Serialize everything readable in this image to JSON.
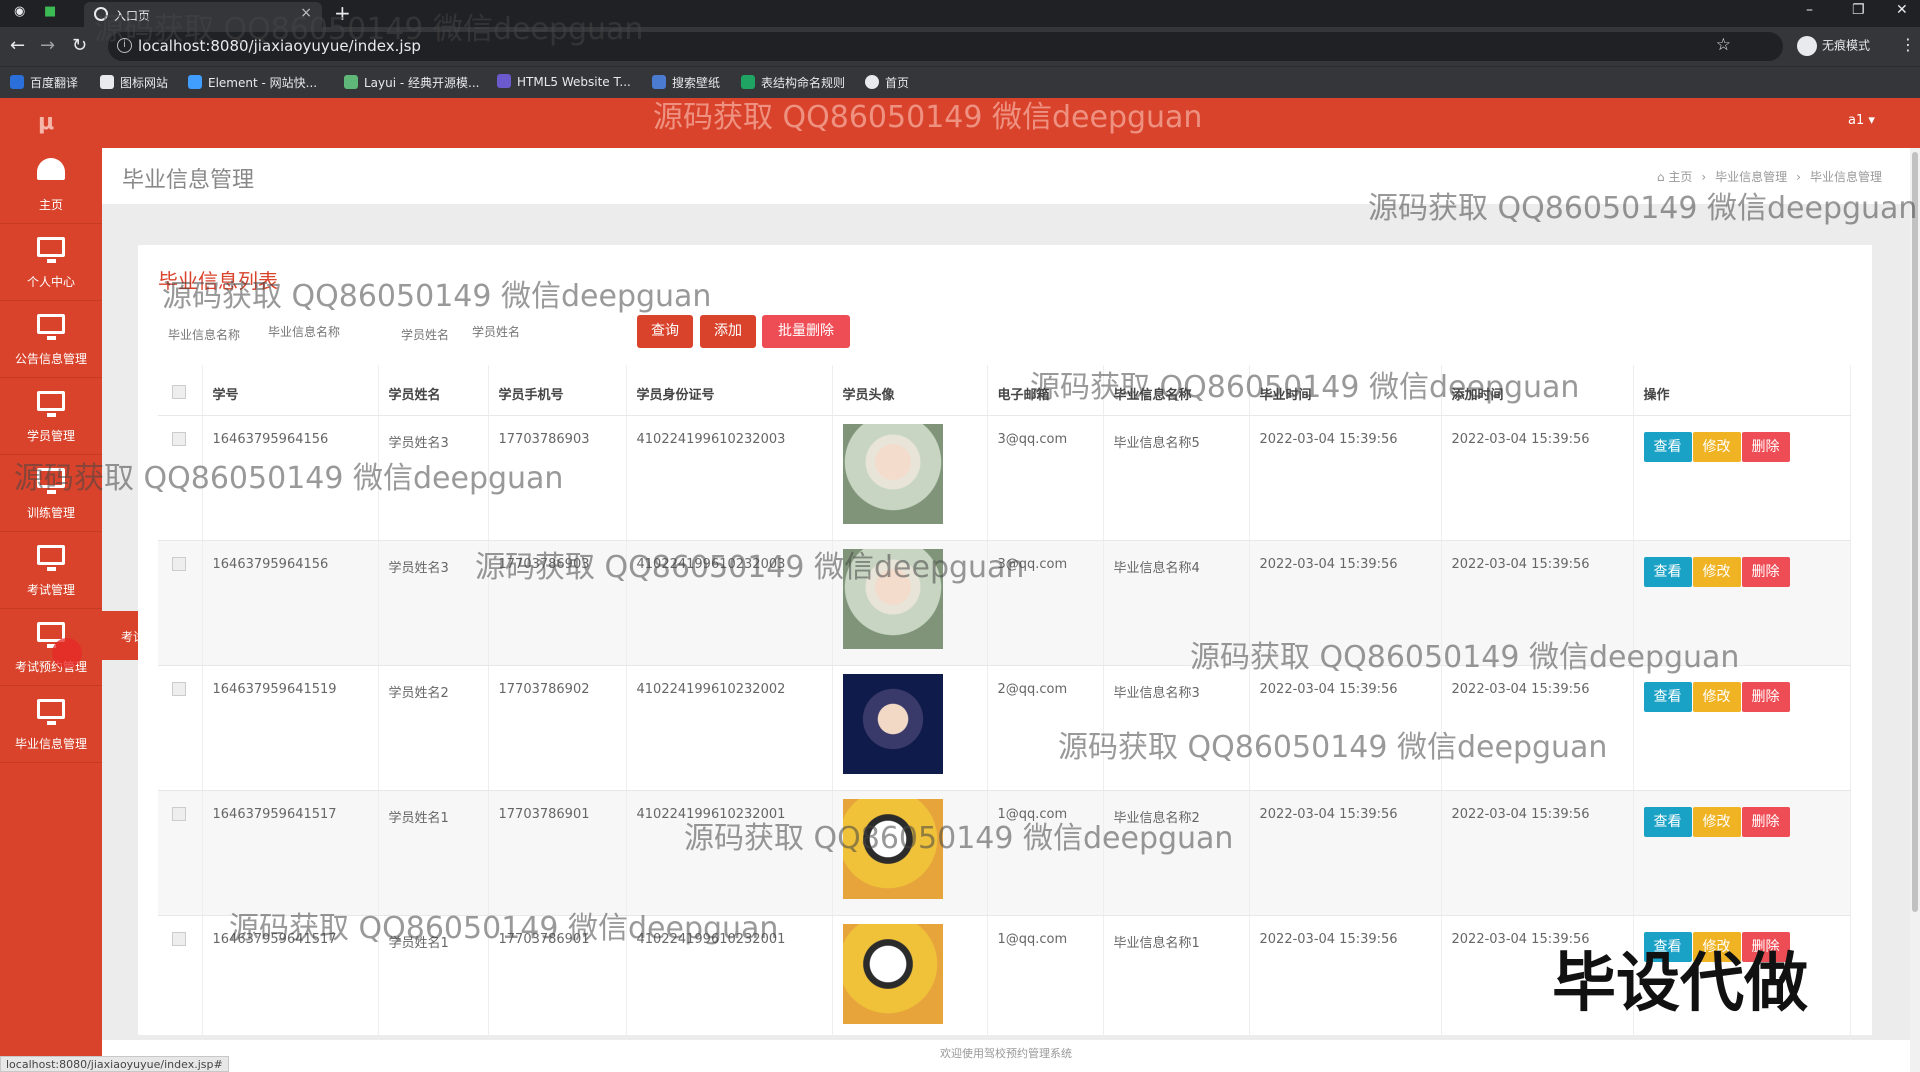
{
  "browser": {
    "tab_title": "入口页",
    "url": "localhost:8080/jiaxiaoyuyue/index.jsp",
    "incognito_label": "无痕模式",
    "bookmarks": [
      "百度翻译",
      "图标网站",
      "Element - 网站快...",
      "Layui - 经典开源模...",
      "HTML5 Website T...",
      "搜索壁纸",
      "表结构命名规则",
      "首页"
    ],
    "status_url": "localhost:8080/jiaxiaoyuyue/index.jsp#"
  },
  "app": {
    "logo": "μ",
    "user": "a1 ▾",
    "sidebar": [
      {
        "label": "主页",
        "icon": "dashboard-icon"
      },
      {
        "label": "个人中心",
        "icon": "monitor-icon"
      },
      {
        "label": "公告信息管理",
        "icon": "monitor-icon"
      },
      {
        "label": "学员管理",
        "icon": "monitor-icon"
      },
      {
        "label": "训练管理",
        "icon": "monitor-icon"
      },
      {
        "label": "考试管理",
        "icon": "monitor-icon"
      },
      {
        "label": "考试预约管理",
        "icon": "monitor-icon"
      },
      {
        "label": "毕业信息管理",
        "icon": "monitor-icon"
      }
    ],
    "flyout": "考试预约管理",
    "page_title": "毕业信息管理",
    "breadcrumb": [
      "主页",
      "毕业信息管理",
      "毕业信息管理"
    ],
    "list_title": "毕业信息列表",
    "search": {
      "name_label": "毕业信息名称",
      "name_placeholder": "毕业信息名称",
      "student_label": "学员姓名",
      "student_placeholder": "学员姓名"
    },
    "buttons": {
      "query": "查询",
      "add": "添加",
      "batch_delete": "批量删除"
    },
    "columns": [
      "学号",
      "学员姓名",
      "学员手机号",
      "学员身份证号",
      "学员头像",
      "电子邮箱",
      "毕业信息名称",
      "毕业时间",
      "添加时间",
      "操作"
    ],
    "rows": [
      {
        "id": "16463795964156",
        "name": "学员姓名3",
        "phone": "17703786903",
        "idcard": "410224199610232003",
        "email": "3@qq.com",
        "grad_name": "毕业信息名称5",
        "grad_time": "2022-03-04 15:39:56",
        "add_time": "2022-03-04 15:39:56",
        "avatar": "av1"
      },
      {
        "id": "16463795964156",
        "name": "学员姓名3",
        "phone": "17703786903",
        "idcard": "410224199610232003",
        "email": "3@qq.com",
        "grad_name": "毕业信息名称4",
        "grad_time": "2022-03-04 15:39:56",
        "add_time": "2022-03-04 15:39:56",
        "avatar": "av1"
      },
      {
        "id": "164637959641519",
        "name": "学员姓名2",
        "phone": "17703786902",
        "idcard": "410224199610232002",
        "email": "2@qq.com",
        "grad_name": "毕业信息名称3",
        "grad_time": "2022-03-04 15:39:56",
        "add_time": "2022-03-04 15:39:56",
        "avatar": "av2"
      },
      {
        "id": "164637959641517",
        "name": "学员姓名1",
        "phone": "17703786901",
        "idcard": "410224199610232001",
        "email": "1@qq.com",
        "grad_name": "毕业信息名称2",
        "grad_time": "2022-03-04 15:39:56",
        "add_time": "2022-03-04 15:39:56",
        "avatar": "av3"
      },
      {
        "id": "164637959641517",
        "name": "学员姓名1",
        "phone": "17703786901",
        "idcard": "410224199610232001",
        "email": "1@qq.com",
        "grad_name": "毕业信息名称1",
        "grad_time": "2022-03-04 15:39:56",
        "add_time": "2022-03-04 15:39:56",
        "avatar": "av3"
      }
    ],
    "row_actions": {
      "view": "查看",
      "edit": "修改",
      "delete": "删除"
    },
    "footer": "欢迎使用驾校预约管理系统"
  },
  "overlay": {
    "watermark": "源码获取 QQ86050149 微信deepguan",
    "promo": "毕设代做"
  },
  "colors": {
    "brand": "#d9432b",
    "view": "#1aa2c6",
    "edit": "#f0b323",
    "delete": "#ef4d55"
  }
}
